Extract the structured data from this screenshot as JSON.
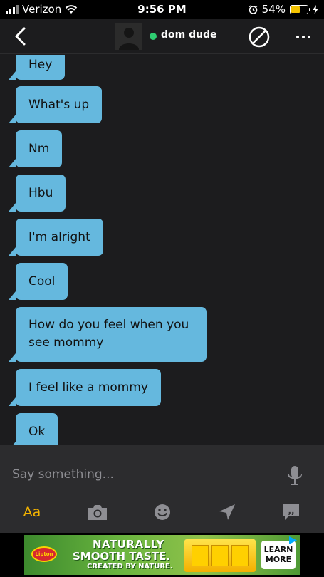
{
  "status_bar": {
    "carrier": "Verizon",
    "time": "9:56 PM",
    "battery_percent": "54%",
    "battery_level": 0.54
  },
  "header": {
    "username": "dom dude",
    "online": true
  },
  "messages": [
    "Hey",
    "What's up",
    "Nm",
    "Hbu",
    "I'm alright",
    "Cool",
    "How do you feel when you see mommy",
    "I feel like a mommy",
    "Ok"
  ],
  "input": {
    "placeholder": "Say something..."
  },
  "toolbar": {
    "text_label": "Aa"
  },
  "ad": {
    "brand": "Lipton",
    "line1": "NATURALLY",
    "line2": "SMOOTH TASTE.",
    "line3": "CREATED BY NATURE.",
    "cta": "LEARN MORE"
  },
  "colors": {
    "bubble": "#65b8de",
    "accent": "#f5b400",
    "online": "#2ecc71",
    "background": "#1c1c1e"
  },
  "icons": [
    "wifi-icon",
    "alarm-icon",
    "charging-icon",
    "back-arrow-icon",
    "block-icon",
    "more-icon",
    "microphone-icon",
    "camera-icon",
    "emoji-icon",
    "location-icon",
    "saved-phrases-icon",
    "ad-choices-icon"
  ]
}
